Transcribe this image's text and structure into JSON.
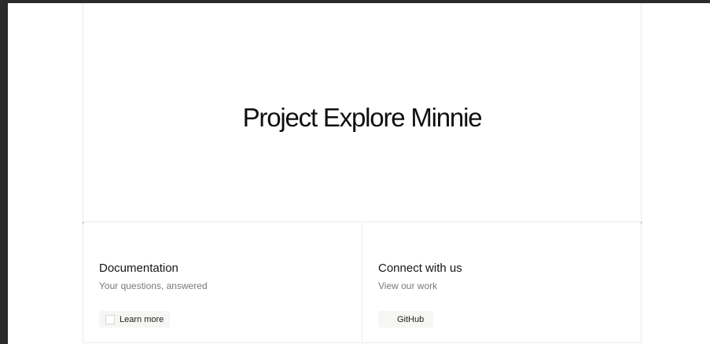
{
  "hero": {
    "title": "Project Explore Minnie"
  },
  "cards": [
    {
      "title": "Documentation",
      "subtitle": "Your questions, answered",
      "button_label": "Learn more"
    },
    {
      "title": "Connect with us",
      "subtitle": "View our work",
      "button_label": "GitHub"
    }
  ]
}
